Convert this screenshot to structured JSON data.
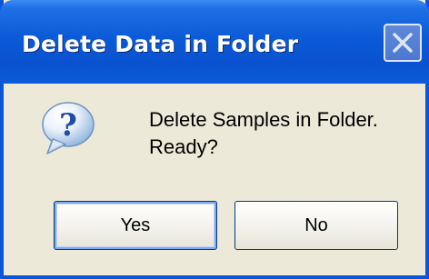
{
  "dialog": {
    "title": "Delete Data in Folder",
    "icon": "question-icon",
    "message": "Delete Samples in Folder.\nReady?",
    "buttons": {
      "yes_label": "Yes",
      "no_label": "No"
    }
  },
  "colors": {
    "titlebar": "#0a56d8",
    "dialog_background": "#ece9d8",
    "title_text": "#ffffff"
  }
}
